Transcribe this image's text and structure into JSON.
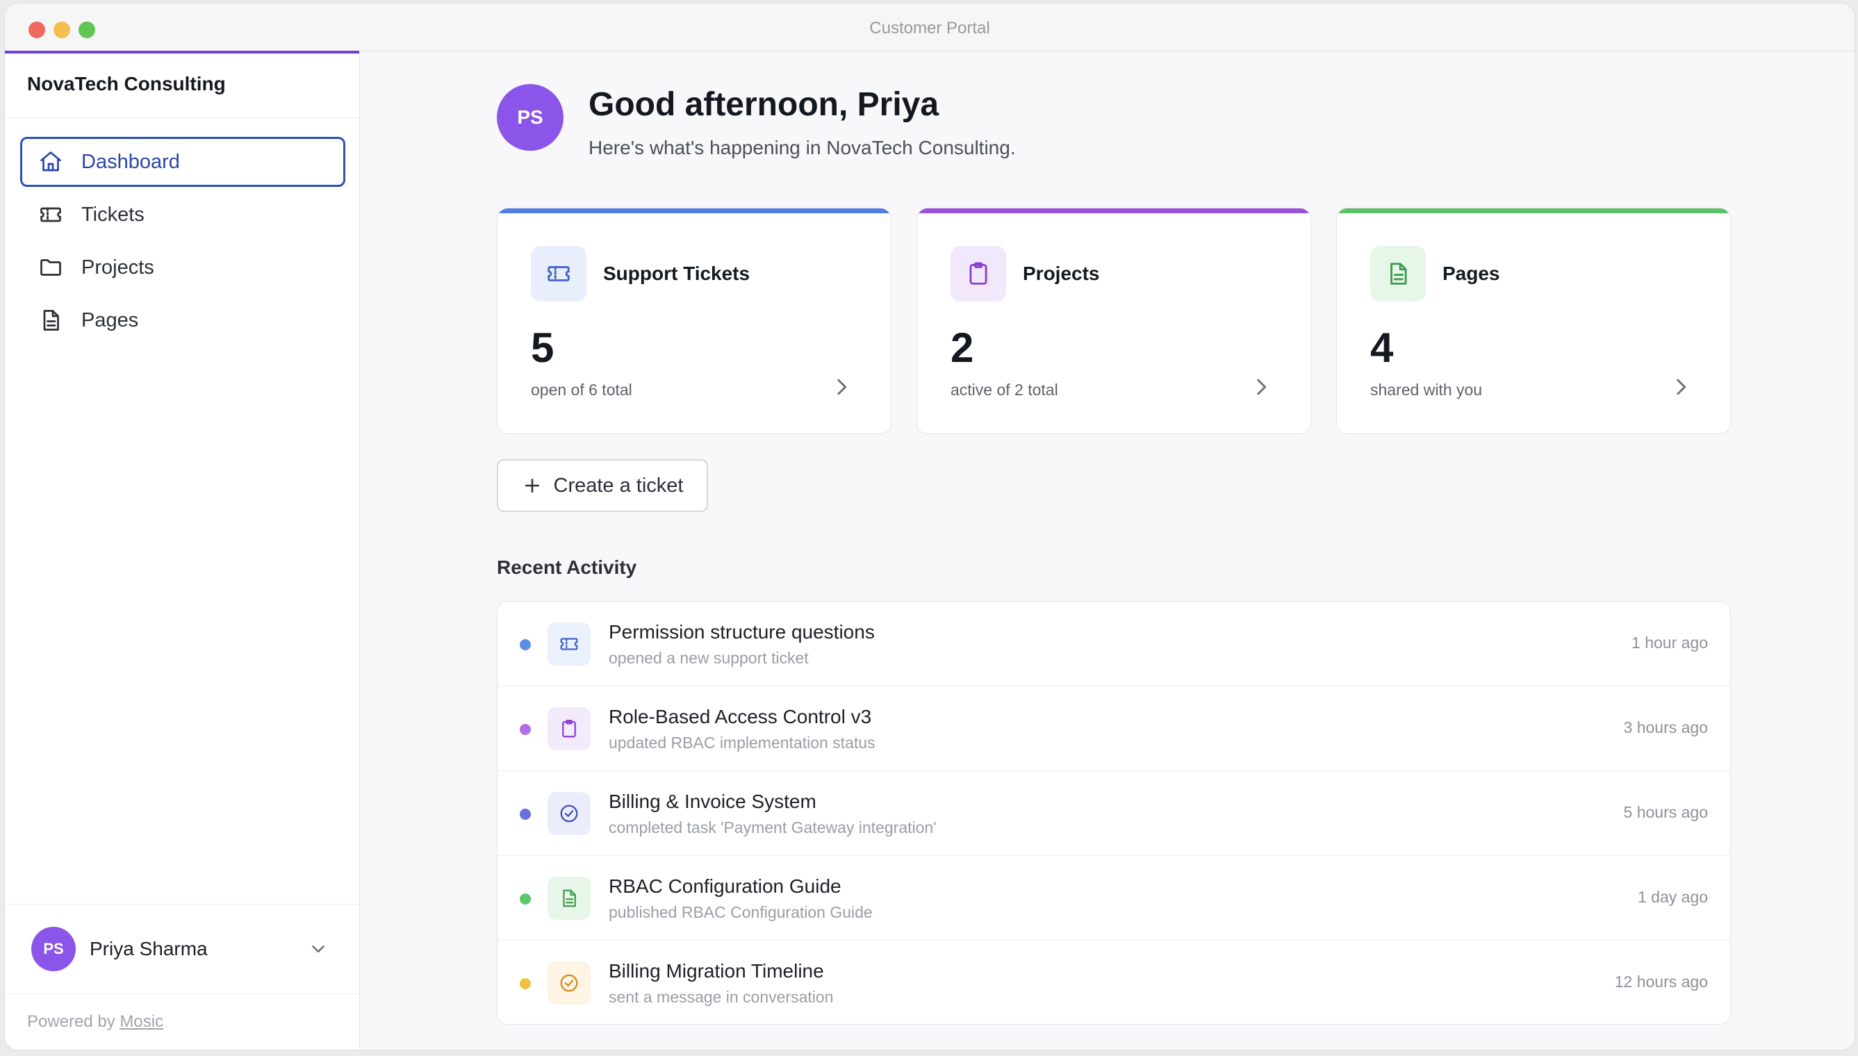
{
  "window": {
    "title": "Customer Portal"
  },
  "sidebar": {
    "org_name": "NovaTech Consulting",
    "items": [
      {
        "label": "Dashboard",
        "icon": "home-icon",
        "active": true
      },
      {
        "label": "Tickets",
        "icon": "ticket-icon",
        "active": false
      },
      {
        "label": "Projects",
        "icon": "folder-icon",
        "active": false
      },
      {
        "label": "Pages",
        "icon": "document-icon",
        "active": false
      }
    ],
    "user": {
      "initials": "PS",
      "name": "Priya Sharma"
    },
    "powered_by": "Powered by",
    "powered_brand": "Mosic"
  },
  "greeting": {
    "initials": "PS",
    "title": "Good afternoon, Priya",
    "subtitle": "Here's what's happening in NovaTech Consulting."
  },
  "cards": [
    {
      "title": "Support Tickets",
      "value": "5",
      "subtitle": "open of 6 total",
      "icon": "ticket-icon",
      "accent": "#4f7fe6",
      "icon_bg": "#e8eefc",
      "icon_color": "#3d63c9"
    },
    {
      "title": "Projects",
      "value": "2",
      "subtitle": "active of 2 total",
      "icon": "clipboard-icon",
      "accent": "#9b51e0",
      "icon_bg": "#f1e8fc",
      "icon_color": "#8a3fd1"
    },
    {
      "title": "Pages",
      "value": "4",
      "subtitle": "shared with you",
      "icon": "document-icon",
      "accent": "#5cbf6a",
      "icon_bg": "#e6f6e9",
      "icon_color": "#3f9b4e"
    }
  ],
  "create_button": {
    "label": "Create a ticket"
  },
  "recent": {
    "title": "Recent Activity",
    "items": [
      {
        "title": "Permission structure questions",
        "desc": "opened a new support ticket",
        "time": "1 hour ago",
        "icon": "ticket-icon",
        "dot": "#5b8fe3",
        "icon_bg": "#eaf0fc",
        "icon_color": "#3d63c9"
      },
      {
        "title": "Role-Based Access Control v3",
        "desc": "updated RBAC implementation status",
        "time": "3 hours ago",
        "icon": "clipboard-icon",
        "dot": "#b06fe6",
        "icon_bg": "#f3eafc",
        "icon_color": "#8a3fd1"
      },
      {
        "title": "Billing & Invoice System",
        "desc": "completed task 'Payment Gateway integration'",
        "time": "5 hours ago",
        "icon": "check-circle-icon",
        "dot": "#6a6fe0",
        "icon_bg": "#ecedfb",
        "icon_color": "#3f4bb8"
      },
      {
        "title": "RBAC Configuration Guide",
        "desc": "published RBAC Configuration Guide",
        "time": "1 day ago",
        "icon": "document-icon",
        "dot": "#5cc76b",
        "icon_bg": "#e8f6ea",
        "icon_color": "#3f9b4e"
      },
      {
        "title": "Billing Migration Timeline",
        "desc": "sent a message in conversation",
        "time": "12 hours ago",
        "icon": "check-circle-icon",
        "dot": "#f0c040",
        "icon_bg": "#fdf4e3",
        "icon_color": "#d08a1c"
      }
    ]
  }
}
